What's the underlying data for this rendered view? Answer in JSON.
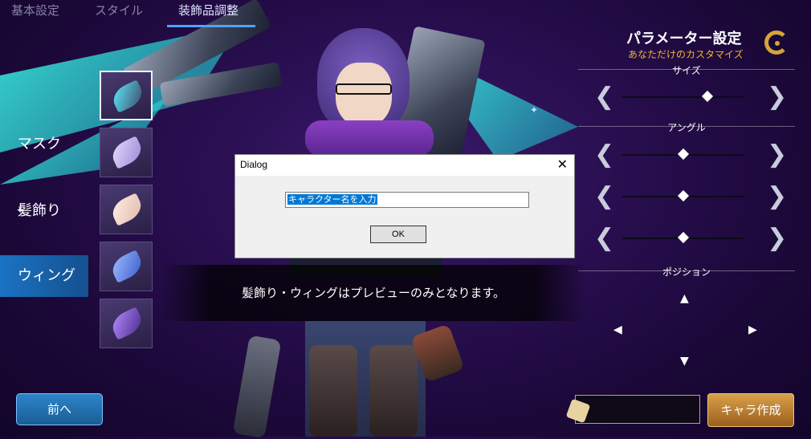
{
  "tabs": {
    "basic": "基本設定",
    "partial": "スタイル",
    "accessory": "装飾品調整"
  },
  "categories": {
    "mask": "マスク",
    "hair_ornament": "髪飾り",
    "wing": "ウィング"
  },
  "parameter_panel": {
    "title": "パラメーター設定",
    "subtitle": "あなただけのカスタマイズ",
    "size_label": "サイズ",
    "angle_label": "アングル",
    "position_label": "ポジション",
    "sliders": [
      {
        "name": "size",
        "value": 0.7
      },
      {
        "name": "angle-1",
        "value": 0.5
      },
      {
        "name": "angle-2",
        "value": 0.5
      },
      {
        "name": "angle-3",
        "value": 0.5
      }
    ]
  },
  "dialog": {
    "title": "Dialog",
    "close": "✕",
    "input_value": "キャラクター名を入力",
    "ok_label": "OK"
  },
  "notice": "髪飾り・ウィングはプレビューのみとなります。",
  "buttons": {
    "prev": "前へ",
    "create": "キャラ作成"
  },
  "icons": {
    "chevron_left": "❮",
    "chevron_right": "❯",
    "up": "▲",
    "down": "▼",
    "left": "◀",
    "right": "▶"
  },
  "colors": {
    "accent_blue": "#1b73c4",
    "accent_gold": "#d9a04a",
    "subtitle_gold": "#f2b233"
  }
}
